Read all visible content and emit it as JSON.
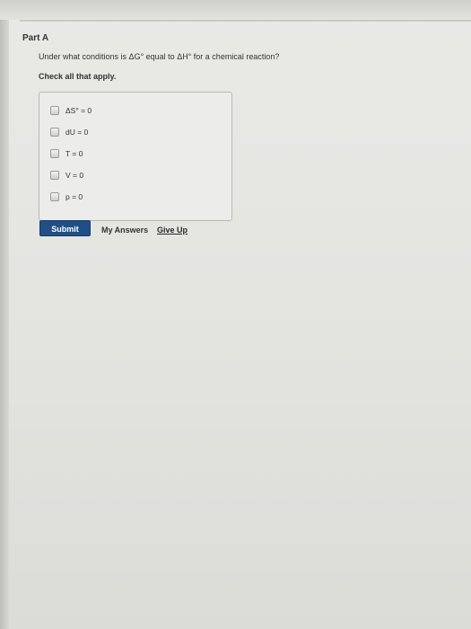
{
  "part": {
    "title": "Part A"
  },
  "question": {
    "text": "Under what conditions is ΔG° equal to ΔH° for a chemical reaction?",
    "instruction": "Check all that apply."
  },
  "options": [
    {
      "label": "ΔS° = 0",
      "checked": false
    },
    {
      "label": "dU = 0",
      "checked": false
    },
    {
      "label": "T = 0",
      "checked": false
    },
    {
      "label": "V = 0",
      "checked": false
    },
    {
      "label": "p = 0",
      "checked": false
    }
  ],
  "actions": {
    "submit_label": "Submit",
    "my_answers_label": "My Answers",
    "give_up_label": "Give Up"
  },
  "colors": {
    "submit_bg": "#1f4f86",
    "page_bg": "#e5e5e2"
  }
}
